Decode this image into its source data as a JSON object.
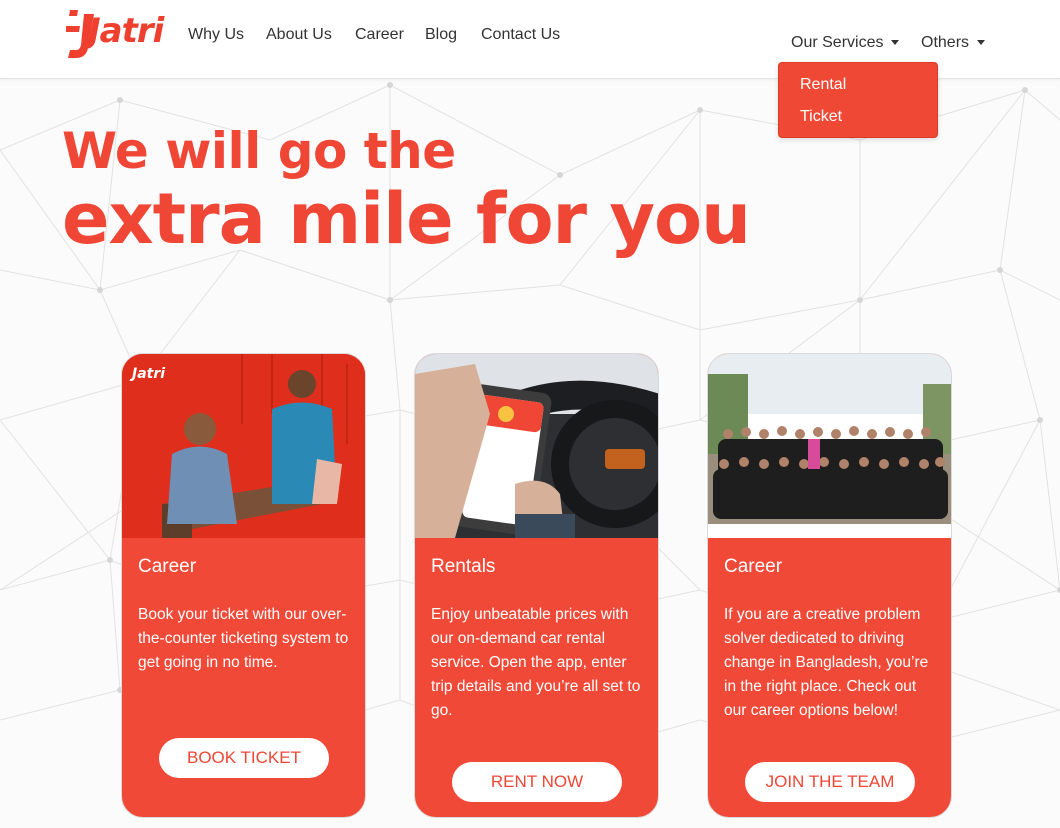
{
  "brand": {
    "name": "Jatri",
    "color": "#ef4635"
  },
  "nav": {
    "links": [
      "Why Us",
      "About Us",
      "Career",
      "Blog",
      "Contact Us"
    ],
    "our_services": "Our Services",
    "others": "Others",
    "services_menu": [
      "Rental",
      "Ticket"
    ]
  },
  "hero": {
    "line1": "We will go the",
    "line2": "extra mile for you"
  },
  "cards": [
    {
      "title": "Career",
      "body": "Book your ticket with our over-the-counter ticketing system to get going in no time.",
      "button": "Book Ticket",
      "image_label": "Jatri"
    },
    {
      "title": "Rentals",
      "body": "Enjoy unbeatable prices with our on-demand car rental service. Open the app, enter trip details and you’re all set to go.",
      "button": "Rent Now"
    },
    {
      "title": "Career",
      "body": "If you are a creative problem solver dedicated to driving change in Bangladesh, you’re in the right place. Check out our career options below!",
      "button": "Join the Team"
    }
  ]
}
